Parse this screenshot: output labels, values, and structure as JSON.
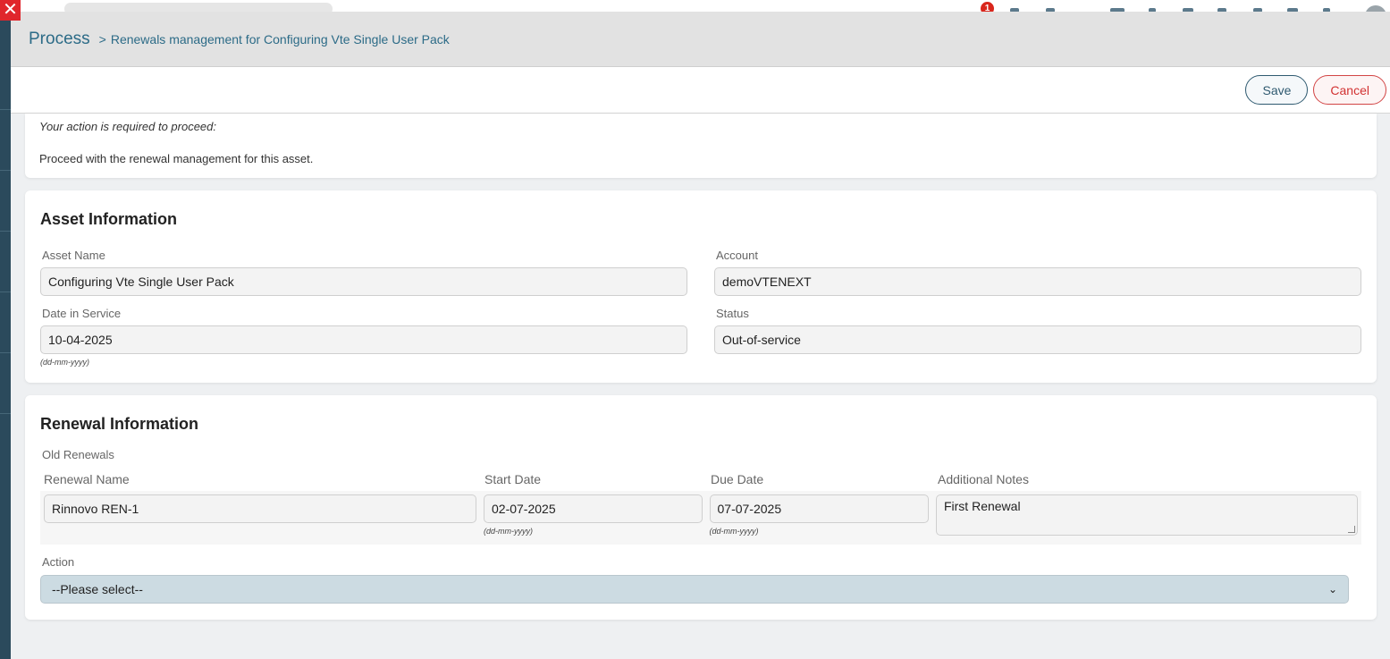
{
  "background": {
    "notification_count": "1"
  },
  "modal": {
    "breadcrumb_root": "Process",
    "breadcrumb_separator": ">",
    "breadcrumb_title": "Renewals management for Configuring Vte Single User Pack",
    "save_label": "Save",
    "cancel_label": "Cancel"
  },
  "message": {
    "heading": "Your action is required to proceed:",
    "text": "Proceed with the renewal management for this asset."
  },
  "asset": {
    "title": "Asset Information",
    "asset_name_label": "Asset Name",
    "asset_name_value": "Configuring Vte Single User Pack",
    "account_label": "Account",
    "account_value": "demoVTENEXT",
    "date_in_service_label": "Date in Service",
    "date_in_service_value": "10-04-2025",
    "date_format_hint": "(dd-mm-yyyy)",
    "status_label": "Status",
    "status_value": "Out-of-service"
  },
  "renewal": {
    "title": "Renewal Information",
    "old_renewals_label": "Old Renewals",
    "columns": [
      "Renewal Name",
      "Start Date",
      "Due Date",
      "Additional Notes"
    ],
    "rows": [
      {
        "name": "Rinnovo REN-1",
        "start_date": "02-07-2025",
        "due_date": "07-07-2025",
        "notes": "First Renewal"
      }
    ],
    "date_format_hint": "(dd-mm-yyyy)",
    "action_label": "Action",
    "action_selected": "--Please select--"
  },
  "colors": {
    "accent": "#2c6b87",
    "cancel": "#d23232",
    "close": "#e0262c"
  }
}
